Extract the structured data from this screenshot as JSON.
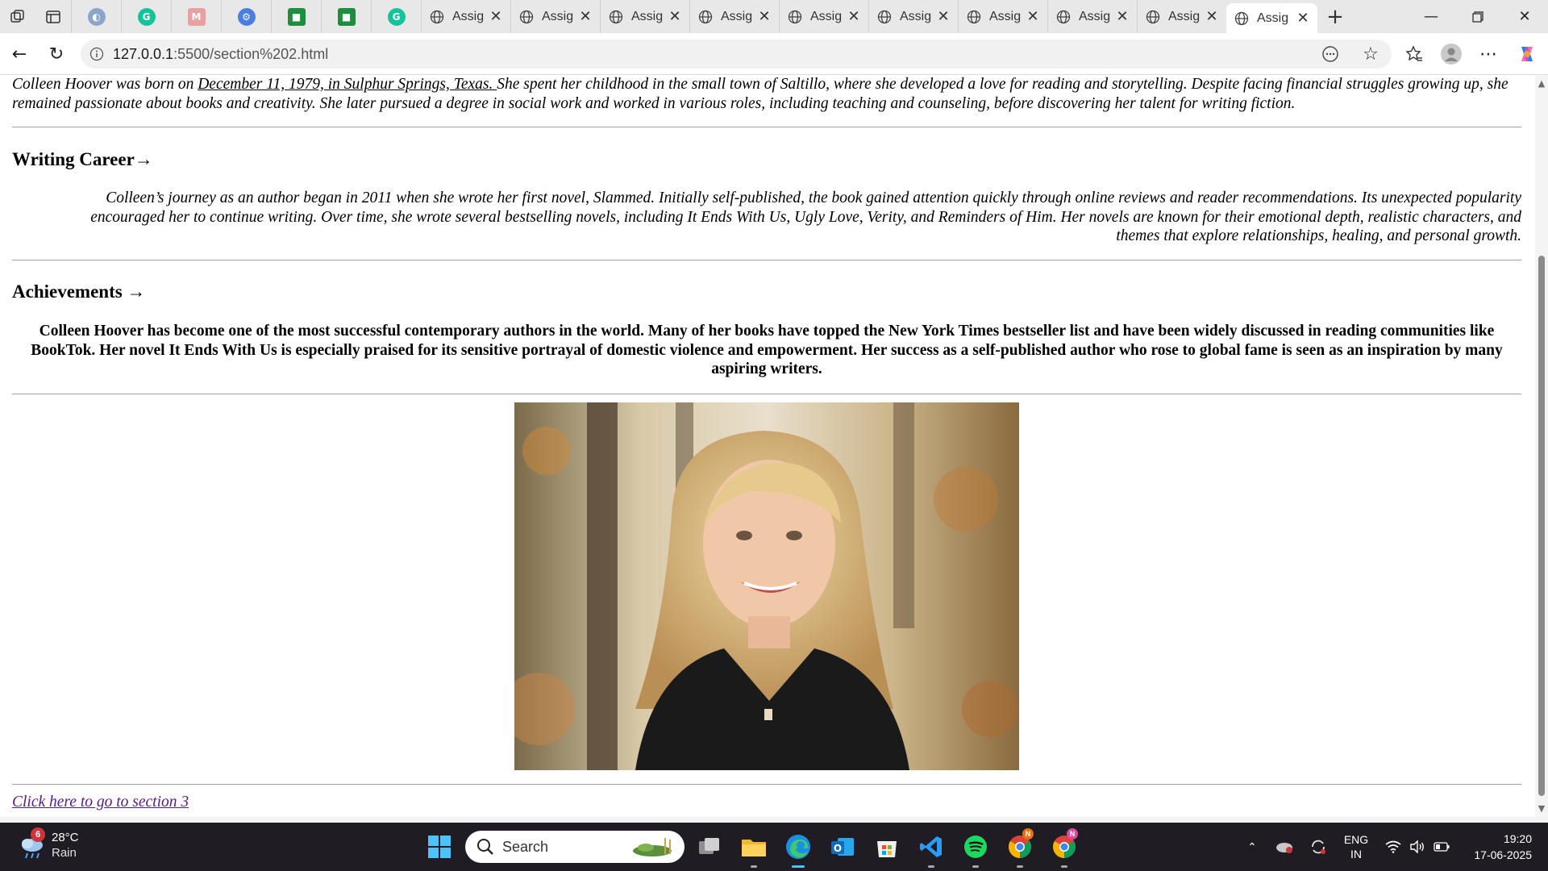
{
  "browser": {
    "tabs": [
      {
        "title": "Assig"
      },
      {
        "title": "Assig"
      },
      {
        "title": "Assig"
      },
      {
        "title": "Assig"
      },
      {
        "title": "Assig"
      },
      {
        "title": "Assig"
      },
      {
        "title": "Assig"
      },
      {
        "title": "Assig"
      },
      {
        "title": "Assig"
      },
      {
        "title": "Assig"
      }
    ],
    "url_host": "127.0.0.1",
    "url_path": ":5500/section%202.html"
  },
  "page": {
    "intro": {
      "lead": "Colleen Hoover was born on ",
      "birth": "December 11, 1979, in Sulphur Springs, Texas. ",
      "rest": "She spent her childhood in the small town of Saltillo, where she developed a love for reading and storytelling. Despite facing financial struggles growing up, she remained passionate about books and creativity. She later pursued a degree in social work and worked in various roles, including teaching and counseling, before discovering her talent for writing fiction."
    },
    "career": {
      "heading": "Writing Career→",
      "text": "Colleen’s journey as an author began in 2011 when she wrote her first novel, Slammed. Initially self-published, the book gained attention quickly through online reviews and reader recommendations. Its unexpected popularity encouraged her to continue writing. Over time, she wrote several bestselling novels, including It Ends With Us, Ugly Love, Verity, and Reminders of Him. Her novels are known for their emotional depth, realistic characters, and themes that explore relationships, healing, and personal growth."
    },
    "achievements": {
      "heading": "Achievements →",
      "text": "Colleen Hoover has become one of the most successful contemporary authors in the world. Many of her books have topped the New York Times bestseller list and have been widely discussed in reading communities like BookTok. Her novel It Ends With Us is especially praised for its sensitive portrayal of domestic violence and empowerment. Her success as a self-published author who rose to global fame is seen as an inspiration by many aspiring writers."
    },
    "link_section3": "Click here to go to section 3"
  },
  "taskbar": {
    "weather_temp": "28°C",
    "weather_cond": "Rain",
    "weather_badge": "6",
    "search_label": "Search",
    "lang_top": "ENG",
    "lang_bottom": "IN",
    "time": "19:20",
    "date": "17-06-2025"
  }
}
